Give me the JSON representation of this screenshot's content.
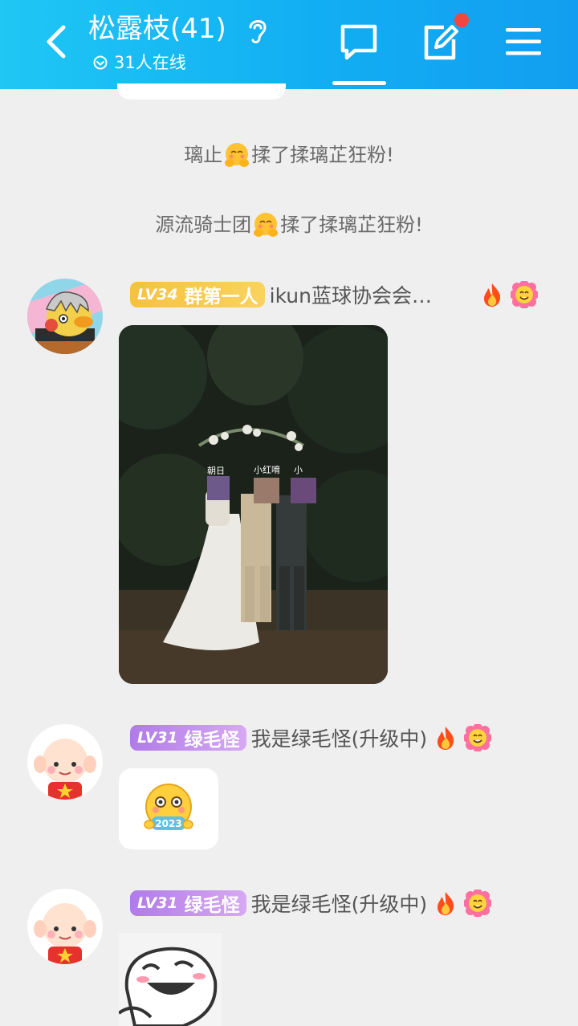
{
  "header": {
    "title": "松露枝(41)",
    "online": "31人在线",
    "icons": [
      "back-arrow-icon",
      "ear-icon",
      "chat-icon",
      "edit-icon",
      "menu-icon"
    ],
    "accent": "#12aef3"
  },
  "system_messages": [
    {
      "name": "璃止",
      "text": "揉了揉璃芷狂粉!"
    },
    {
      "name": "源流骑士团",
      "text": "揉了揉璃芷狂粉!"
    }
  ],
  "messages": [
    {
      "level": "LV34",
      "title": "群第一人",
      "nickname": "ikun蓝球协会会…",
      "content": "photo",
      "photo_labels": [
        "朝日",
        "小红唷",
        "小"
      ]
    },
    {
      "level": "LV31",
      "title": "绿毛怪",
      "nickname": "我是绿毛怪(升级中)",
      "content": "sticker",
      "sticker_text": "2023"
    },
    {
      "level": "LV31",
      "title": "绿毛怪",
      "nickname": "我是绿毛怪(升级中)",
      "content": "sticker"
    }
  ]
}
